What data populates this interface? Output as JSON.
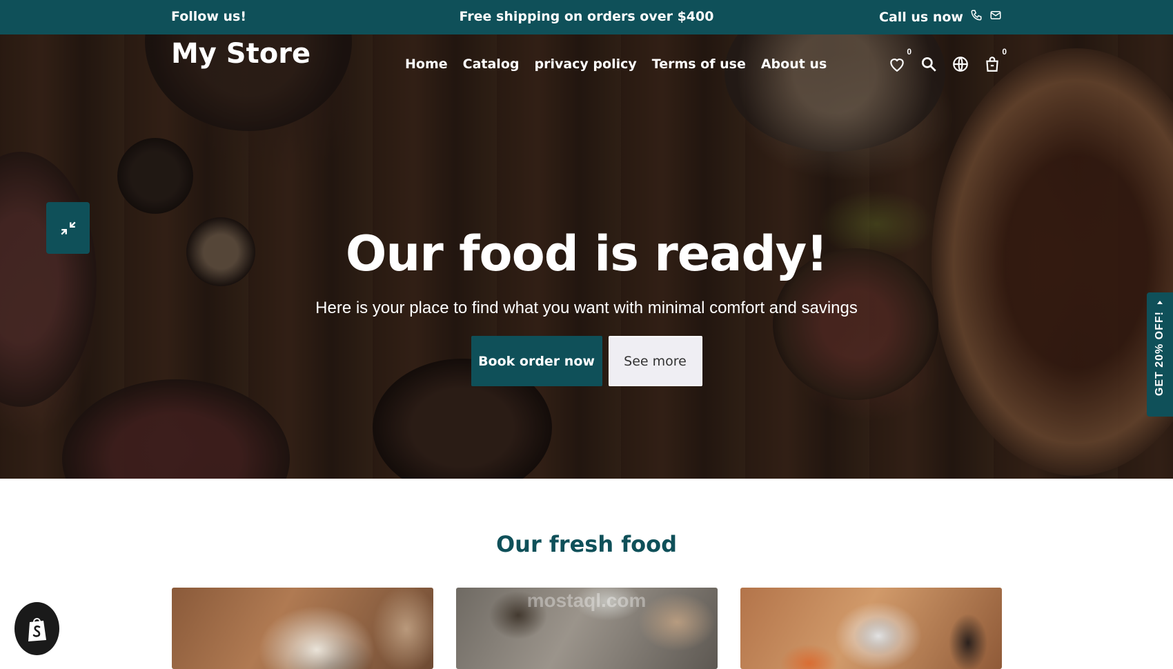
{
  "topbar": {
    "follow_label": "Follow us!",
    "shipping_text": "Free shipping on orders over $400",
    "call_label": "Call us now"
  },
  "header": {
    "logo": "My Store",
    "nav": [
      {
        "label": "Home"
      },
      {
        "label": "Catalog"
      },
      {
        "label": "privacy policy"
      },
      {
        "label": "Terms of use"
      },
      {
        "label": "About us"
      }
    ],
    "wishlist_count": "0",
    "cart_count": "0"
  },
  "hero": {
    "title": "Our food is ready!",
    "subtitle": "Here is your place to find what you want with minimal comfort and savings",
    "primary_button": "Book order now",
    "secondary_button": "See more"
  },
  "discount_tab": "GET 20% OFF!",
  "section": {
    "title": "Our fresh food"
  },
  "watermark": "mostaql.com",
  "colors": {
    "brand": "#0f5059",
    "secondary_button_bg": "#efeef3"
  },
  "icons": [
    "phone-icon",
    "mail-icon",
    "heart-icon",
    "search-icon",
    "globe-icon",
    "bag-icon",
    "collapse-arrows-icon",
    "shopify-icon"
  ]
}
